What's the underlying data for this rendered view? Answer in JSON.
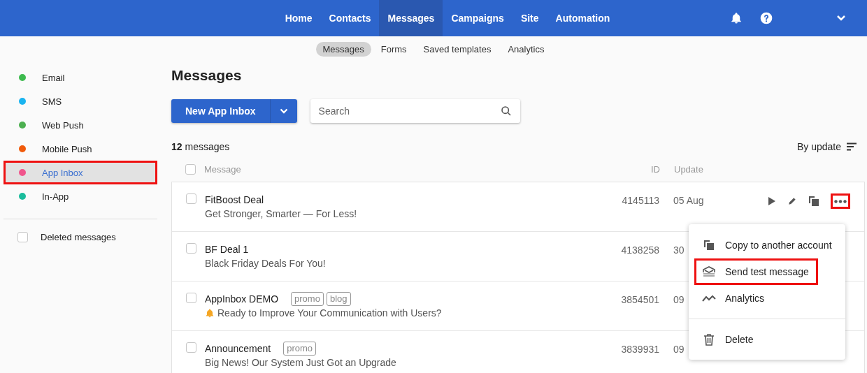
{
  "top_nav": {
    "items": [
      {
        "label": "Home",
        "selected": false
      },
      {
        "label": "Contacts",
        "selected": false
      },
      {
        "label": "Messages",
        "selected": true
      },
      {
        "label": "Campaigns",
        "selected": false
      },
      {
        "label": "Site",
        "selected": false
      },
      {
        "label": "Automation",
        "selected": false
      }
    ]
  },
  "sub_nav": {
    "items": [
      {
        "label": "Messages",
        "selected": true
      },
      {
        "label": "Forms",
        "selected": false
      },
      {
        "label": "Saved templates",
        "selected": false
      },
      {
        "label": "Analytics",
        "selected": false
      }
    ]
  },
  "sidebar": {
    "items": [
      {
        "label": "Email",
        "color": "#3dba4e",
        "selected": false,
        "highlighted": false
      },
      {
        "label": "SMS",
        "color": "#1ab4f0",
        "selected": false,
        "highlighted": false
      },
      {
        "label": "Web Push",
        "color": "#4caf50",
        "selected": false,
        "highlighted": false
      },
      {
        "label": "Mobile Push",
        "color": "#f05a0a",
        "selected": false,
        "highlighted": false
      },
      {
        "label": "App Inbox",
        "color": "#f0558c",
        "selected": true,
        "highlighted": true
      },
      {
        "label": "In-App",
        "color": "#1abc9c",
        "selected": false,
        "highlighted": false
      }
    ],
    "deleted": {
      "label": "Deleted messages",
      "checked": false
    }
  },
  "main": {
    "title": "Messages",
    "new_button": "New App Inbox",
    "search": {
      "placeholder": "Search"
    },
    "count": "**12** messages",
    "sort": "By update",
    "columns": [
      "Message",
      "ID",
      "Update"
    ],
    "all_checked": false,
    "rows": [
      {
        "name": "FitBoost Deal",
        "tags": [],
        "description": "Get Stronger, Smarter — For Less!",
        "bell": false,
        "id": "4145113",
        "update": "05 Aug",
        "checked": false,
        "actions": true
      },
      {
        "name": "BF Deal 1",
        "tags": [],
        "description": "Black Friday Deals For You!",
        "bell": false,
        "id": "4138258",
        "update": "30",
        "checked": false,
        "actions": false
      },
      {
        "name": "AppInbox DEMO",
        "tags": [
          "promo",
          "blog"
        ],
        "description": "Ready to Improve Your Communication with Users?",
        "bell": true,
        "id": "3854501",
        "update": "09",
        "checked": false,
        "actions": false
      },
      {
        "name": "Announcement",
        "tags": [
          "promo"
        ],
        "description": "Big News! Our System Just Got an Upgrade",
        "bell": false,
        "id": "3839931",
        "update": "09",
        "checked": false,
        "actions": false
      }
    ],
    "more_highlighted": true
  },
  "menu": {
    "items": [
      {
        "kind": "copy",
        "label": "Copy to another account",
        "highlighted": false
      },
      {
        "kind": "test",
        "label": "Send test message",
        "highlighted": true
      },
      {
        "kind": "analytics",
        "label": "Analytics",
        "highlighted": false
      },
      {
        "kind": "delete",
        "label": "Delete",
        "highlighted": false
      }
    ]
  }
}
